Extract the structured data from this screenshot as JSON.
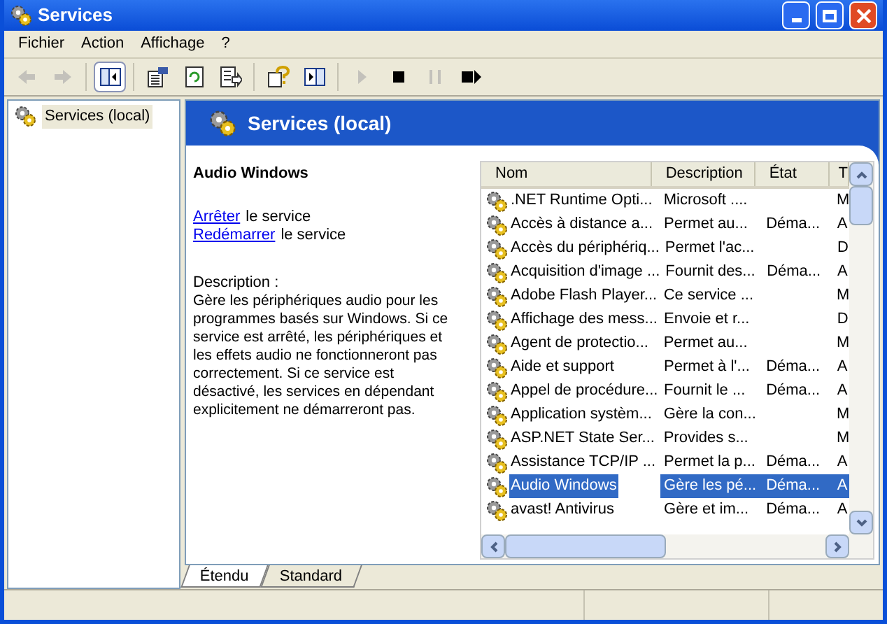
{
  "window": {
    "title": "Services"
  },
  "menu": [
    "Fichier",
    "Action",
    "Affichage",
    "?"
  ],
  "toolbar": [
    {
      "kind": "back",
      "disabled": true,
      "pressed": false
    },
    {
      "kind": "forward",
      "disabled": true,
      "pressed": false
    },
    {
      "kind": "sep"
    },
    {
      "kind": "tree",
      "disabled": false,
      "pressed": true
    },
    {
      "kind": "sep"
    },
    {
      "kind": "properties",
      "disabled": false,
      "pressed": false
    },
    {
      "kind": "refresh",
      "disabled": false,
      "pressed": false
    },
    {
      "kind": "export",
      "disabled": false,
      "pressed": false
    },
    {
      "kind": "sep"
    },
    {
      "kind": "help",
      "disabled": false,
      "pressed": false
    },
    {
      "kind": "view",
      "disabled": false,
      "pressed": false
    },
    {
      "kind": "sep"
    },
    {
      "kind": "play",
      "disabled": true,
      "pressed": false
    },
    {
      "kind": "stop",
      "disabled": false,
      "pressed": false
    },
    {
      "kind": "pause",
      "disabled": true,
      "pressed": false
    },
    {
      "kind": "restart",
      "disabled": false,
      "pressed": false
    }
  ],
  "tree": [
    {
      "label": "Services (local)",
      "selected": true
    }
  ],
  "pane_title": "Services (local)",
  "details": {
    "title": "Audio Windows",
    "actions": [
      {
        "link": "Arrêter",
        "rest": "le service"
      },
      {
        "link": "Redémarrer",
        "rest": "le service"
      }
    ],
    "description_label": "Description :",
    "description": "Gère les périphériques audio pour les programmes basés sur Windows. Si ce service est arrêté, les périphériques et les effets audio ne fonctionneront pas correctement. Si ce service est désactivé, les services en dépendant explicitement ne démarreront pas."
  },
  "table": {
    "columns": [
      "Nom",
      "Description",
      "État",
      "T"
    ],
    "rows": [
      {
        "name": ".NET Runtime Opti...",
        "description": "Microsoft ....",
        "state": "",
        "column_4": "M",
        "selected": false
      },
      {
        "name": "Accès à distance a...",
        "description": "Permet au...",
        "state": "Déma...",
        "column_4": "A",
        "selected": false
      },
      {
        "name": "Accès du périphériq...",
        "description": "Permet l'ac...",
        "state": "",
        "column_4": "D",
        "selected": false
      },
      {
        "name": "Acquisition d'image ...",
        "description": "Fournit des...",
        "state": "Déma...",
        "column_4": "A",
        "selected": false
      },
      {
        "name": "Adobe Flash Player...",
        "description": "Ce service ...",
        "state": "",
        "column_4": "M",
        "selected": false
      },
      {
        "name": "Affichage des mess...",
        "description": "Envoie et r...",
        "state": "",
        "column_4": "D",
        "selected": false
      },
      {
        "name": "Agent de protectio...",
        "description": "Permet au...",
        "state": "",
        "column_4": "M",
        "selected": false
      },
      {
        "name": "Aide et support",
        "description": "Permet à l'...",
        "state": "Déma...",
        "column_4": "A",
        "selected": false
      },
      {
        "name": "Appel de procédure...",
        "description": "Fournit le ...",
        "state": "Déma...",
        "column_4": "A",
        "selected": false
      },
      {
        "name": "Application systèm...",
        "description": "Gère la con...",
        "state": "",
        "column_4": "M",
        "selected": false
      },
      {
        "name": "ASP.NET State Ser...",
        "description": "Provides s...",
        "state": "",
        "column_4": "M",
        "selected": false
      },
      {
        "name": "Assistance TCP/IP ...",
        "description": "Permet la p...",
        "state": "Déma...",
        "column_4": "A",
        "selected": false
      },
      {
        "name": "Audio Windows",
        "description": "Gère les pé...",
        "state": "Déma...",
        "column_4": "A",
        "selected": true
      },
      {
        "name": "avast! Antivirus",
        "description": "Gère et im...",
        "state": "Déma...",
        "column_4": "A",
        "selected": false
      }
    ]
  },
  "tabs": [
    {
      "label": "Étendu",
      "selected": true
    },
    {
      "label": "Standard",
      "selected": false
    }
  ]
}
